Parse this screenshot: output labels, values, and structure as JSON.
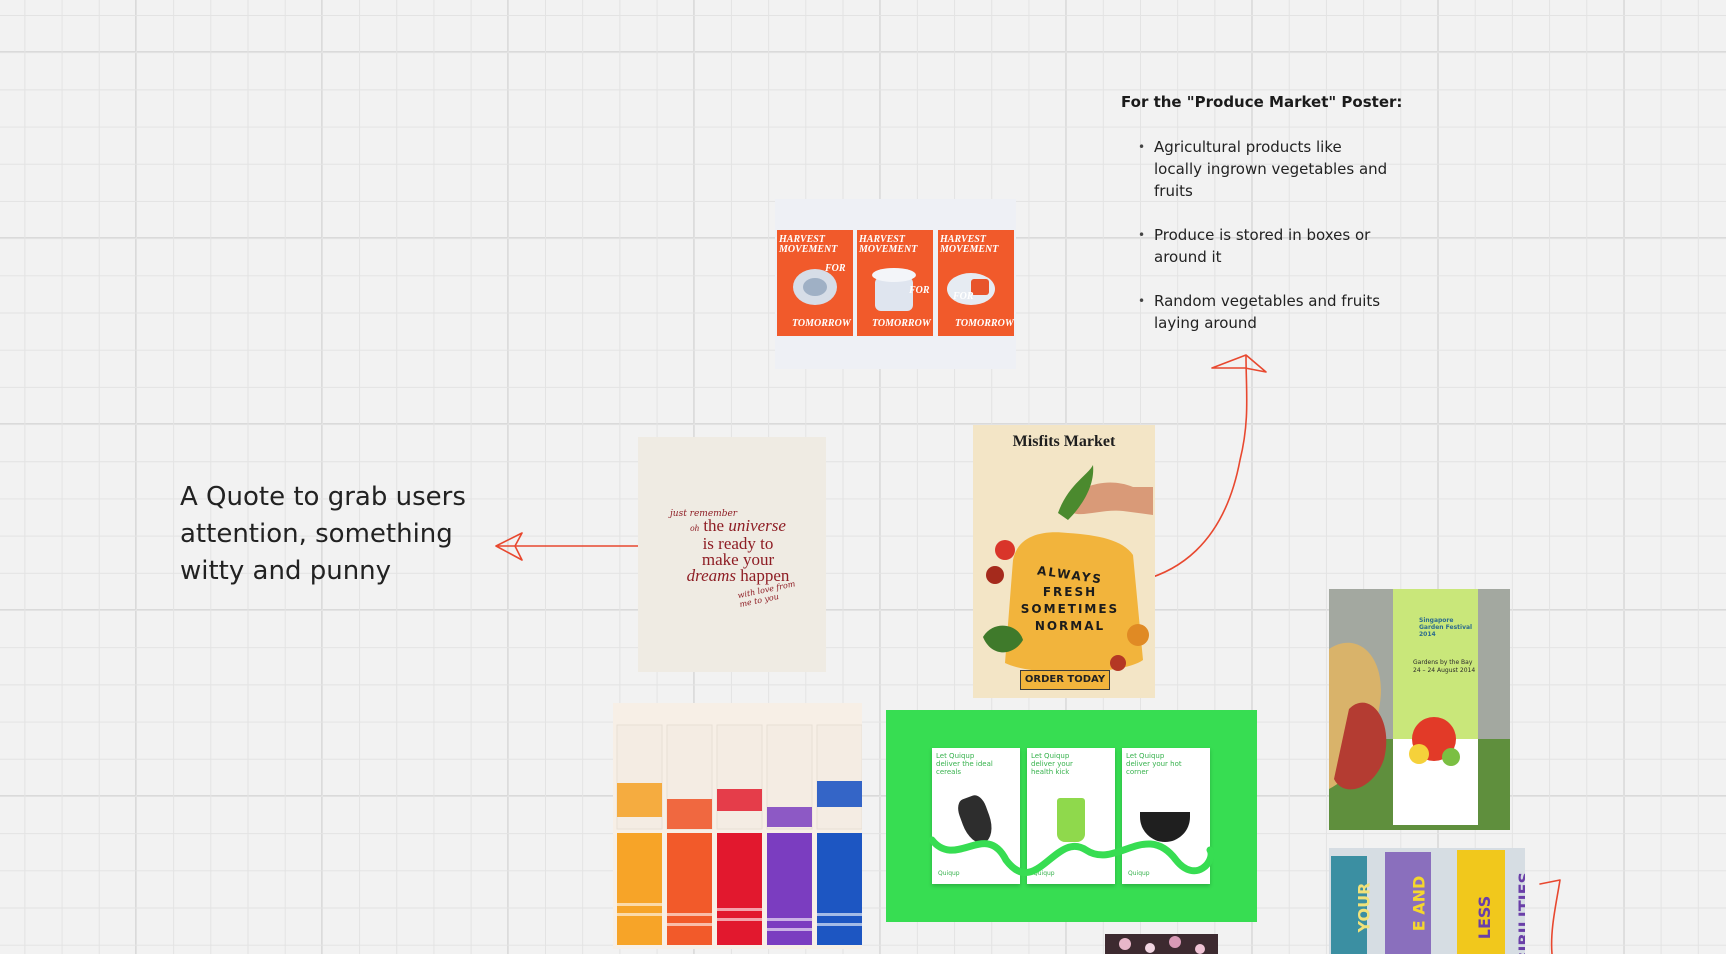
{
  "board": {
    "note": {
      "title": "For the \"Produce Market\" Poster:",
      "bullets": [
        "Agricultural products like locally ingrown vegetables and fruits",
        "Produce is stored in boxes or around it",
        "Random vegetables and fruits laying around"
      ]
    },
    "quote": "A Quote to grab users attention, something witty and punny",
    "images": {
      "harvest": {
        "line1": "HARVEST",
        "line2": "MOVEMENT",
        "line3": "FOR",
        "line4": "TOMORROW"
      },
      "universe": {
        "script_top": "just remember",
        "oh": "oh",
        "line1a": "the",
        "line1b": "universe",
        "line2": "is ready to",
        "line3": "make your",
        "line4a": "dreams",
        "line4b": "happen",
        "script_bottom": "with love from me to you"
      },
      "misfits": {
        "brand": "Misfits Market",
        "bag1": "ALWAYS",
        "bag2": "FRESH",
        "bag3": "SOMETIMES",
        "bag4": "NORMAL",
        "cta": "ORDER TODAY"
      },
      "festival": {
        "title": "Singapore Garden Festival 2014",
        "venue": "Gardens by the Bay",
        "dates": "24 – 24 August 2014"
      },
      "green_posters": {
        "card1": "Let Quiqup deliver the ideal cereals",
        "card2": "Let Quiqup deliver your health kick",
        "card3": "Let Quiqup deliver your hot corner",
        "brand": "Quiqup"
      },
      "banners": {
        "b1": "YOUR",
        "b2": "E AND",
        "b3": "LESS",
        "b4": "SIBILITIES"
      }
    },
    "colors": {
      "arrow": "#e8482f",
      "harvest_orange": "#f15a2b",
      "green": "#37dd52",
      "misfits_bg": "#f3e5c6",
      "bag_yellow": "#f2b43c"
    }
  }
}
